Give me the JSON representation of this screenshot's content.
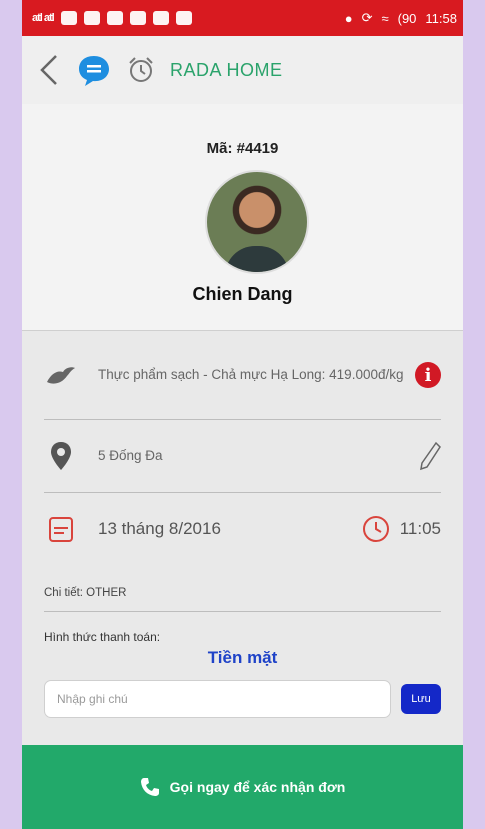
{
  "status_bar": {
    "signal": "atl atl",
    "battery": "(90",
    "time": "11:58"
  },
  "app_bar": {
    "title": "RADA HOME"
  },
  "profile": {
    "code": "Mã: #4419",
    "name": "Chien Dang"
  },
  "order": {
    "product": "Thực phẩm sạch - Chả mực Hạ Long: 419.000đ/kg",
    "address": "5 Đống Đa",
    "date": "13 tháng 8/2016",
    "time": "11:05",
    "detail": "Chi tiết: OTHER",
    "payment_label": "Hình thức thanh toán:",
    "payment_value": "Tiền mặt"
  },
  "note": {
    "placeholder": "Nhập ghi chú",
    "save_label": "Lưu"
  },
  "call": {
    "label": "Gọi ngay để xác nhận đơn"
  },
  "colors": {
    "status_bar": "#d81a20",
    "brand": "#2aa36b",
    "call_bar": "#22a96a",
    "payment": "#1f43c8",
    "save": "#1428c8"
  }
}
